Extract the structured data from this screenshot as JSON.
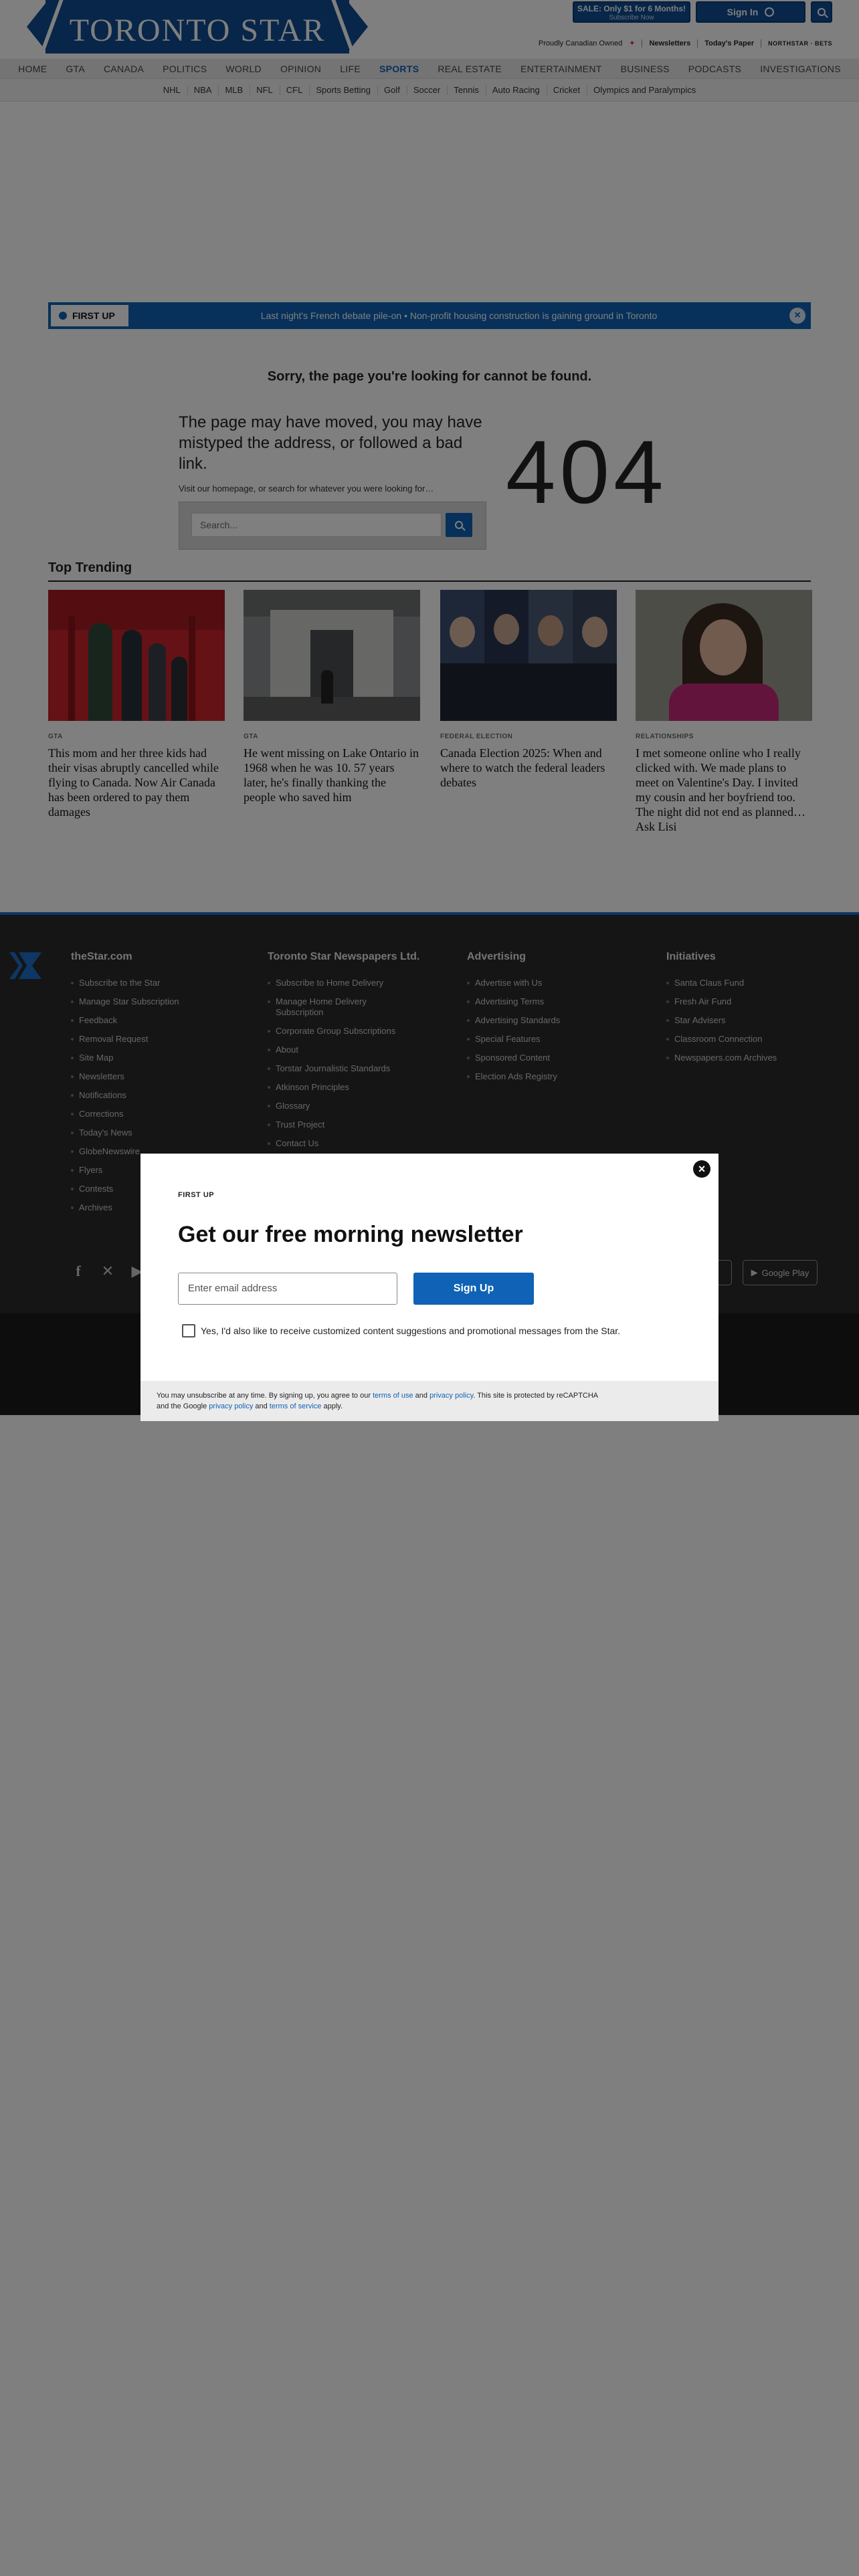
{
  "header": {
    "logo_text": "TORONTO STAR",
    "sale_line1": "SALE: Only $1 for 6 Months!",
    "sale_line2": "Subscribe Now",
    "signin_label": "Sign In",
    "util": {
      "canadian": "Proudly Canadian Owned",
      "newsletters": "Newsletters",
      "todays_paper": "Today's Paper",
      "bets": "NORTHSTAR · BETS"
    }
  },
  "nav_primary": [
    "HOME",
    "GTA",
    "CANADA",
    "POLITICS",
    "WORLD",
    "OPINION",
    "LIFE",
    "SPORTS",
    "REAL ESTATE",
    "ENTERTAINMENT",
    "BUSINESS",
    "PODCASTS",
    "INVESTIGATIONS"
  ],
  "nav_secondary": [
    "NHL",
    "NBA",
    "MLB",
    "NFL",
    "CFL",
    "Sports Betting",
    "Golf",
    "Soccer",
    "Tennis",
    "Auto Racing",
    "Cricket",
    "Olympics and Paralympics"
  ],
  "first_up": {
    "label": "FIRST UP",
    "text": "Last night's French debate pile-on • Non-profit housing construction is gaining ground in Toronto"
  },
  "error": {
    "sorry": "Sorry, the page you're looking for cannot be found.",
    "headline": "The page may have moved, you may have mistyped the address, or followed a bad link.",
    "sub": "Visit our homepage, or search for whatever you were looking for…",
    "search_placeholder": "Search...",
    "code": "404"
  },
  "trending": {
    "title": "Top Trending",
    "cards": [
      {
        "category": "GTA",
        "headline": "This mom and her three kids had their visas abruptly cancelled while flying to Canada. Now Air Canada has been ordered to pay them damages"
      },
      {
        "category": "GTA",
        "headline": "He went missing on Lake Ontario in 1968 when he was 10. 57 years later, he's finally thanking the people who saved him"
      },
      {
        "category": "FEDERAL ELECTION",
        "headline": "Canada Election 2025: When and where to watch the federal leaders debates"
      },
      {
        "category": "RELATIONSHIPS",
        "headline": "I met someone online who I really clicked with. We made plans to meet on Valentine's Day. I invited my cousin and her boyfriend too. The night did not end as planned… Ask Lisi"
      }
    ]
  },
  "footer": {
    "cols": [
      {
        "title": "theStar.com",
        "items": [
          "Subscribe to the Star",
          "Manage Star Subscription",
          "Feedback",
          "Removal Request",
          "Site Map",
          "Newsletters",
          "Notifications",
          "Corrections",
          "Today's News",
          "GlobeNewswire",
          "Flyers",
          "Contests",
          "Archives"
        ]
      },
      {
        "title": "Toronto Star Newspapers Ltd.",
        "items": [
          "Subscribe to Home Delivery",
          "Manage Home Delivery Subscription",
          "Corporate Group Subscriptions",
          "About",
          "Torstar Journalistic Standards",
          "Atkinson Principles",
          "Glossary",
          "Trust Project",
          "Contact Us"
        ]
      },
      {
        "title": "Advertising",
        "items": [
          "Advertise with Us",
          "Advertising Terms",
          "Advertising Standards",
          "Special Features",
          "Sponsored Content",
          "Election Ads Registry"
        ]
      },
      {
        "title": "Initiatives",
        "items": [
          "Santa Claus Fund",
          "Fresh Air Fund",
          "Star Advisers",
          "Classroom Connection",
          "Newspapers.com Archives"
        ]
      }
    ],
    "google_play": "Google Play"
  },
  "modal": {
    "kicker": "FIRST UP",
    "title": "Get our free morning newsletter",
    "email_placeholder": "Enter email address",
    "signup_label": "Sign Up",
    "consent": "Yes, I'd also like to receive customized content suggestions and promotional messages from the Star.",
    "legal": {
      "t1": "You may unsubscribe at any time. By signing up, you agree to our ",
      "terms_of_use": "terms of use",
      "and1": " and ",
      "privacy_policy": "privacy policy",
      "t2": ". This site is protected by reCAPTCHA",
      "t3": "and the Google ",
      "g_privacy": "privacy policy",
      "and2": " and ",
      "g_terms": "terms of service",
      "t4": " apply."
    }
  },
  "colors": {
    "brand_blue": "#0f4c92",
    "accent_blue": "#0f62b5",
    "footer_bg": "#2a2a2a"
  }
}
